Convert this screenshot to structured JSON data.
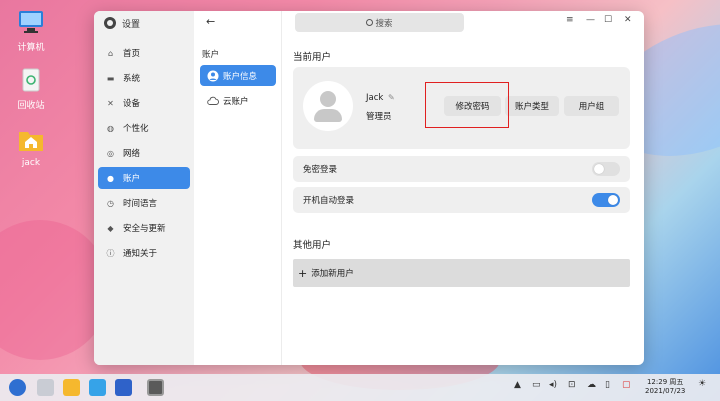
{
  "desktop": {
    "icons": [
      {
        "label": "计算机",
        "icon": "computer-icon"
      },
      {
        "label": "回收站",
        "icon": "trash-icon"
      },
      {
        "label": "jack",
        "icon": "home-folder-icon"
      }
    ]
  },
  "window": {
    "app_title": "设置",
    "nav": [
      {
        "label": "首页",
        "icon": "home-icon"
      },
      {
        "label": "系统",
        "icon": "monitor-icon"
      },
      {
        "label": "设备",
        "icon": "tools-icon"
      },
      {
        "label": "个性化",
        "icon": "palette-icon"
      },
      {
        "label": "网络",
        "icon": "globe-icon"
      },
      {
        "label": "账户",
        "icon": "user-icon",
        "active": true
      },
      {
        "label": "时间语言",
        "icon": "clock-icon"
      },
      {
        "label": "安全与更新",
        "icon": "shield-icon"
      },
      {
        "label": "通知关于",
        "icon": "info-icon"
      }
    ],
    "sub": {
      "title": "账户",
      "items": [
        {
          "label": "账户信息",
          "icon": "user-icon",
          "active": true
        },
        {
          "label": "云账户",
          "icon": "cloud-icon"
        }
      ]
    },
    "search_placeholder": "搜索",
    "current_user": {
      "heading": "当前用户",
      "name": "Jack",
      "role": "管理员",
      "buttons": {
        "change_password": "修改密码",
        "account_type": "账户类型",
        "user_group": "用户组"
      }
    },
    "settings": {
      "password_free_login": {
        "label": "免密登录",
        "on": false
      },
      "auto_login": {
        "label": "开机自动登录",
        "on": true
      }
    },
    "other_users": {
      "heading": "其他用户",
      "add_user": "添加新用户"
    }
  },
  "taskbar": {
    "time": "12:29 周五",
    "date": "2021/07/23"
  },
  "colors": {
    "accent": "#3d8ae8",
    "highlight_box": "#e02020"
  }
}
